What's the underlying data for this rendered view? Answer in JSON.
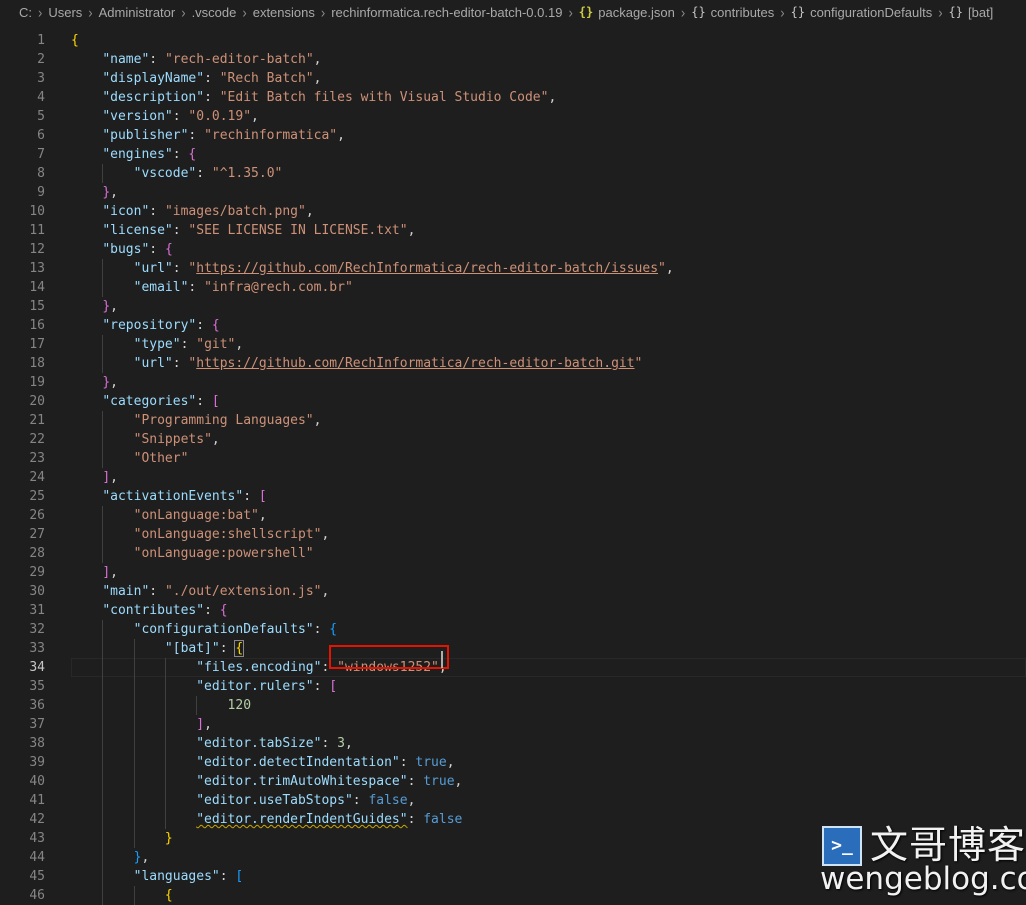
{
  "breadcrumb": {
    "items": [
      "C:",
      "Users",
      "Administrator",
      ".vscode",
      "extensions",
      "rechinformatica.rech-editor-batch-0.0.19",
      "package.json",
      "contributes",
      "configurationDefaults",
      "[bat]"
    ],
    "json_icon": "{}",
    "object_icon": "{}",
    "separator": "›"
  },
  "editor": {
    "active_line": 34,
    "lines": [
      [
        [
          "{",
          "y"
        ]
      ],
      [
        [
          "    ",
          "p"
        ],
        [
          "\"name\"",
          "k"
        ],
        [
          ": ",
          "p"
        ],
        [
          "\"rech-editor-batch\"",
          "s"
        ],
        [
          ",",
          "p"
        ]
      ],
      [
        [
          "    ",
          "p"
        ],
        [
          "\"displayName\"",
          "k"
        ],
        [
          ": ",
          "p"
        ],
        [
          "\"Rech Batch\"",
          "s"
        ],
        [
          ",",
          "p"
        ]
      ],
      [
        [
          "    ",
          "p"
        ],
        [
          "\"description\"",
          "k"
        ],
        [
          ": ",
          "p"
        ],
        [
          "\"Edit Batch files with Visual Studio Code\"",
          "s"
        ],
        [
          ",",
          "p"
        ]
      ],
      [
        [
          "    ",
          "p"
        ],
        [
          "\"version\"",
          "k"
        ],
        [
          ": ",
          "p"
        ],
        [
          "\"0.0.19\"",
          "s"
        ],
        [
          ",",
          "p"
        ]
      ],
      [
        [
          "    ",
          "p"
        ],
        [
          "\"publisher\"",
          "k"
        ],
        [
          ": ",
          "p"
        ],
        [
          "\"rechinformatica\"",
          "s"
        ],
        [
          ",",
          "p"
        ]
      ],
      [
        [
          "    ",
          "p"
        ],
        [
          "\"engines\"",
          "k"
        ],
        [
          ": ",
          "p"
        ],
        [
          "{",
          "m"
        ]
      ],
      [
        [
          "        ",
          "p"
        ],
        [
          "\"vscode\"",
          "k"
        ],
        [
          ": ",
          "p"
        ],
        [
          "\"^1.35.0\"",
          "s"
        ]
      ],
      [
        [
          "    ",
          "p"
        ],
        [
          "}",
          "m"
        ],
        [
          ",",
          "p"
        ]
      ],
      [
        [
          "    ",
          "p"
        ],
        [
          "\"icon\"",
          "k"
        ],
        [
          ": ",
          "p"
        ],
        [
          "\"images/batch.png\"",
          "s"
        ],
        [
          ",",
          "p"
        ]
      ],
      [
        [
          "    ",
          "p"
        ],
        [
          "\"license\"",
          "k"
        ],
        [
          ": ",
          "p"
        ],
        [
          "\"SEE LICENSE IN LICENSE.txt\"",
          "s"
        ],
        [
          ",",
          "p"
        ]
      ],
      [
        [
          "    ",
          "p"
        ],
        [
          "\"bugs\"",
          "k"
        ],
        [
          ": ",
          "p"
        ],
        [
          "{",
          "m"
        ]
      ],
      [
        [
          "        ",
          "p"
        ],
        [
          "\"url\"",
          "k"
        ],
        [
          ": ",
          "p"
        ],
        [
          "\"",
          "s"
        ],
        [
          "https://github.com/RechInformatica/rech-editor-batch/issues",
          "su"
        ],
        [
          "\"",
          "s"
        ],
        [
          ",",
          "p"
        ]
      ],
      [
        [
          "        ",
          "p"
        ],
        [
          "\"email\"",
          "k"
        ],
        [
          ": ",
          "p"
        ],
        [
          "\"infra@rech.com.br\"",
          "s"
        ]
      ],
      [
        [
          "    ",
          "p"
        ],
        [
          "}",
          "m"
        ],
        [
          ",",
          "p"
        ]
      ],
      [
        [
          "    ",
          "p"
        ],
        [
          "\"repository\"",
          "k"
        ],
        [
          ": ",
          "p"
        ],
        [
          "{",
          "m"
        ]
      ],
      [
        [
          "        ",
          "p"
        ],
        [
          "\"type\"",
          "k"
        ],
        [
          ": ",
          "p"
        ],
        [
          "\"git\"",
          "s"
        ],
        [
          ",",
          "p"
        ]
      ],
      [
        [
          "        ",
          "p"
        ],
        [
          "\"url\"",
          "k"
        ],
        [
          ": ",
          "p"
        ],
        [
          "\"",
          "s"
        ],
        [
          "https://github.com/RechInformatica/rech-editor-batch.git",
          "su"
        ],
        [
          "\"",
          "s"
        ]
      ],
      [
        [
          "    ",
          "p"
        ],
        [
          "}",
          "m"
        ],
        [
          ",",
          "p"
        ]
      ],
      [
        [
          "    ",
          "p"
        ],
        [
          "\"categories\"",
          "k"
        ],
        [
          ": ",
          "p"
        ],
        [
          "[",
          "m"
        ]
      ],
      [
        [
          "        ",
          "p"
        ],
        [
          "\"Programming Languages\"",
          "s"
        ],
        [
          ",",
          "p"
        ]
      ],
      [
        [
          "        ",
          "p"
        ],
        [
          "\"Snippets\"",
          "s"
        ],
        [
          ",",
          "p"
        ]
      ],
      [
        [
          "        ",
          "p"
        ],
        [
          "\"Other\"",
          "s"
        ]
      ],
      [
        [
          "    ",
          "p"
        ],
        [
          "]",
          "m"
        ],
        [
          ",",
          "p"
        ]
      ],
      [
        [
          "    ",
          "p"
        ],
        [
          "\"activationEvents\"",
          "k"
        ],
        [
          ": ",
          "p"
        ],
        [
          "[",
          "m"
        ]
      ],
      [
        [
          "        ",
          "p"
        ],
        [
          "\"onLanguage:bat\"",
          "s"
        ],
        [
          ",",
          "p"
        ]
      ],
      [
        [
          "        ",
          "p"
        ],
        [
          "\"onLanguage:shellscript\"",
          "s"
        ],
        [
          ",",
          "p"
        ]
      ],
      [
        [
          "        ",
          "p"
        ],
        [
          "\"onLanguage:powershell\"",
          "s"
        ]
      ],
      [
        [
          "    ",
          "p"
        ],
        [
          "]",
          "m"
        ],
        [
          ",",
          "p"
        ]
      ],
      [
        [
          "    ",
          "p"
        ],
        [
          "\"main\"",
          "k"
        ],
        [
          ": ",
          "p"
        ],
        [
          "\"./out/extension.js\"",
          "s"
        ],
        [
          ",",
          "p"
        ]
      ],
      [
        [
          "    ",
          "p"
        ],
        [
          "\"contributes\"",
          "k"
        ],
        [
          ": ",
          "p"
        ],
        [
          "{",
          "m"
        ]
      ],
      [
        [
          "        ",
          "p"
        ],
        [
          "\"configurationDefaults\"",
          "k"
        ],
        [
          ": ",
          "p"
        ],
        [
          "{",
          "bl"
        ]
      ],
      [
        [
          "            ",
          "p"
        ],
        [
          "\"[bat]\"",
          "k"
        ],
        [
          ": ",
          "p"
        ],
        [
          "{",
          "yb"
        ]
      ],
      [
        [
          "                ",
          "p"
        ],
        [
          "\"files.encoding\"",
          "k"
        ],
        [
          ": ",
          "p"
        ],
        [
          "\"windows1252\"",
          "s"
        ],
        [
          ",",
          "p"
        ]
      ],
      [
        [
          "                ",
          "p"
        ],
        [
          "\"editor.rulers\"",
          "k"
        ],
        [
          ": ",
          "p"
        ],
        [
          "[",
          "m"
        ]
      ],
      [
        [
          "                    ",
          "p"
        ],
        [
          "120",
          "n"
        ]
      ],
      [
        [
          "                ",
          "p"
        ],
        [
          "]",
          "m"
        ],
        [
          ",",
          "p"
        ]
      ],
      [
        [
          "                ",
          "p"
        ],
        [
          "\"editor.tabSize\"",
          "k"
        ],
        [
          ": ",
          "p"
        ],
        [
          "3",
          "n"
        ],
        [
          ",",
          "p"
        ]
      ],
      [
        [
          "                ",
          "p"
        ],
        [
          "\"editor.detectIndentation\"",
          "k"
        ],
        [
          ": ",
          "p"
        ],
        [
          "true",
          "b"
        ],
        [
          ",",
          "p"
        ]
      ],
      [
        [
          "                ",
          "p"
        ],
        [
          "\"editor.trimAutoWhitespace\"",
          "k"
        ],
        [
          ": ",
          "p"
        ],
        [
          "true",
          "b"
        ],
        [
          ",",
          "p"
        ]
      ],
      [
        [
          "                ",
          "p"
        ],
        [
          "\"editor.useTabStops\"",
          "k"
        ],
        [
          ": ",
          "p"
        ],
        [
          "false",
          "b"
        ],
        [
          ",",
          "p"
        ]
      ],
      [
        [
          "                ",
          "p"
        ],
        [
          "\"editor.renderIndentGuides\"",
          "kw"
        ],
        [
          ": ",
          "p"
        ],
        [
          "false",
          "b"
        ]
      ],
      [
        [
          "            ",
          "p"
        ],
        [
          "}",
          "yb"
        ]
      ],
      [
        [
          "        ",
          "p"
        ],
        [
          "}",
          "bl"
        ],
        [
          ",",
          "p"
        ]
      ],
      [
        [
          "        ",
          "p"
        ],
        [
          "\"languages\"",
          "k"
        ],
        [
          ": ",
          "p"
        ],
        [
          "[",
          "bl"
        ]
      ],
      [
        [
          "            ",
          "p"
        ],
        [
          "{",
          "y"
        ]
      ]
    ]
  },
  "watermark": {
    "logo_glyph": ">_",
    "title": "文哥博客",
    "url": "wengeblog.com"
  },
  "colors": {
    "background": "#1e1e1e",
    "key": "#9cdcfe",
    "string": "#ce9178",
    "number": "#b5cea8",
    "boolean": "#569cd6",
    "highlight_box": "#e51400"
  }
}
